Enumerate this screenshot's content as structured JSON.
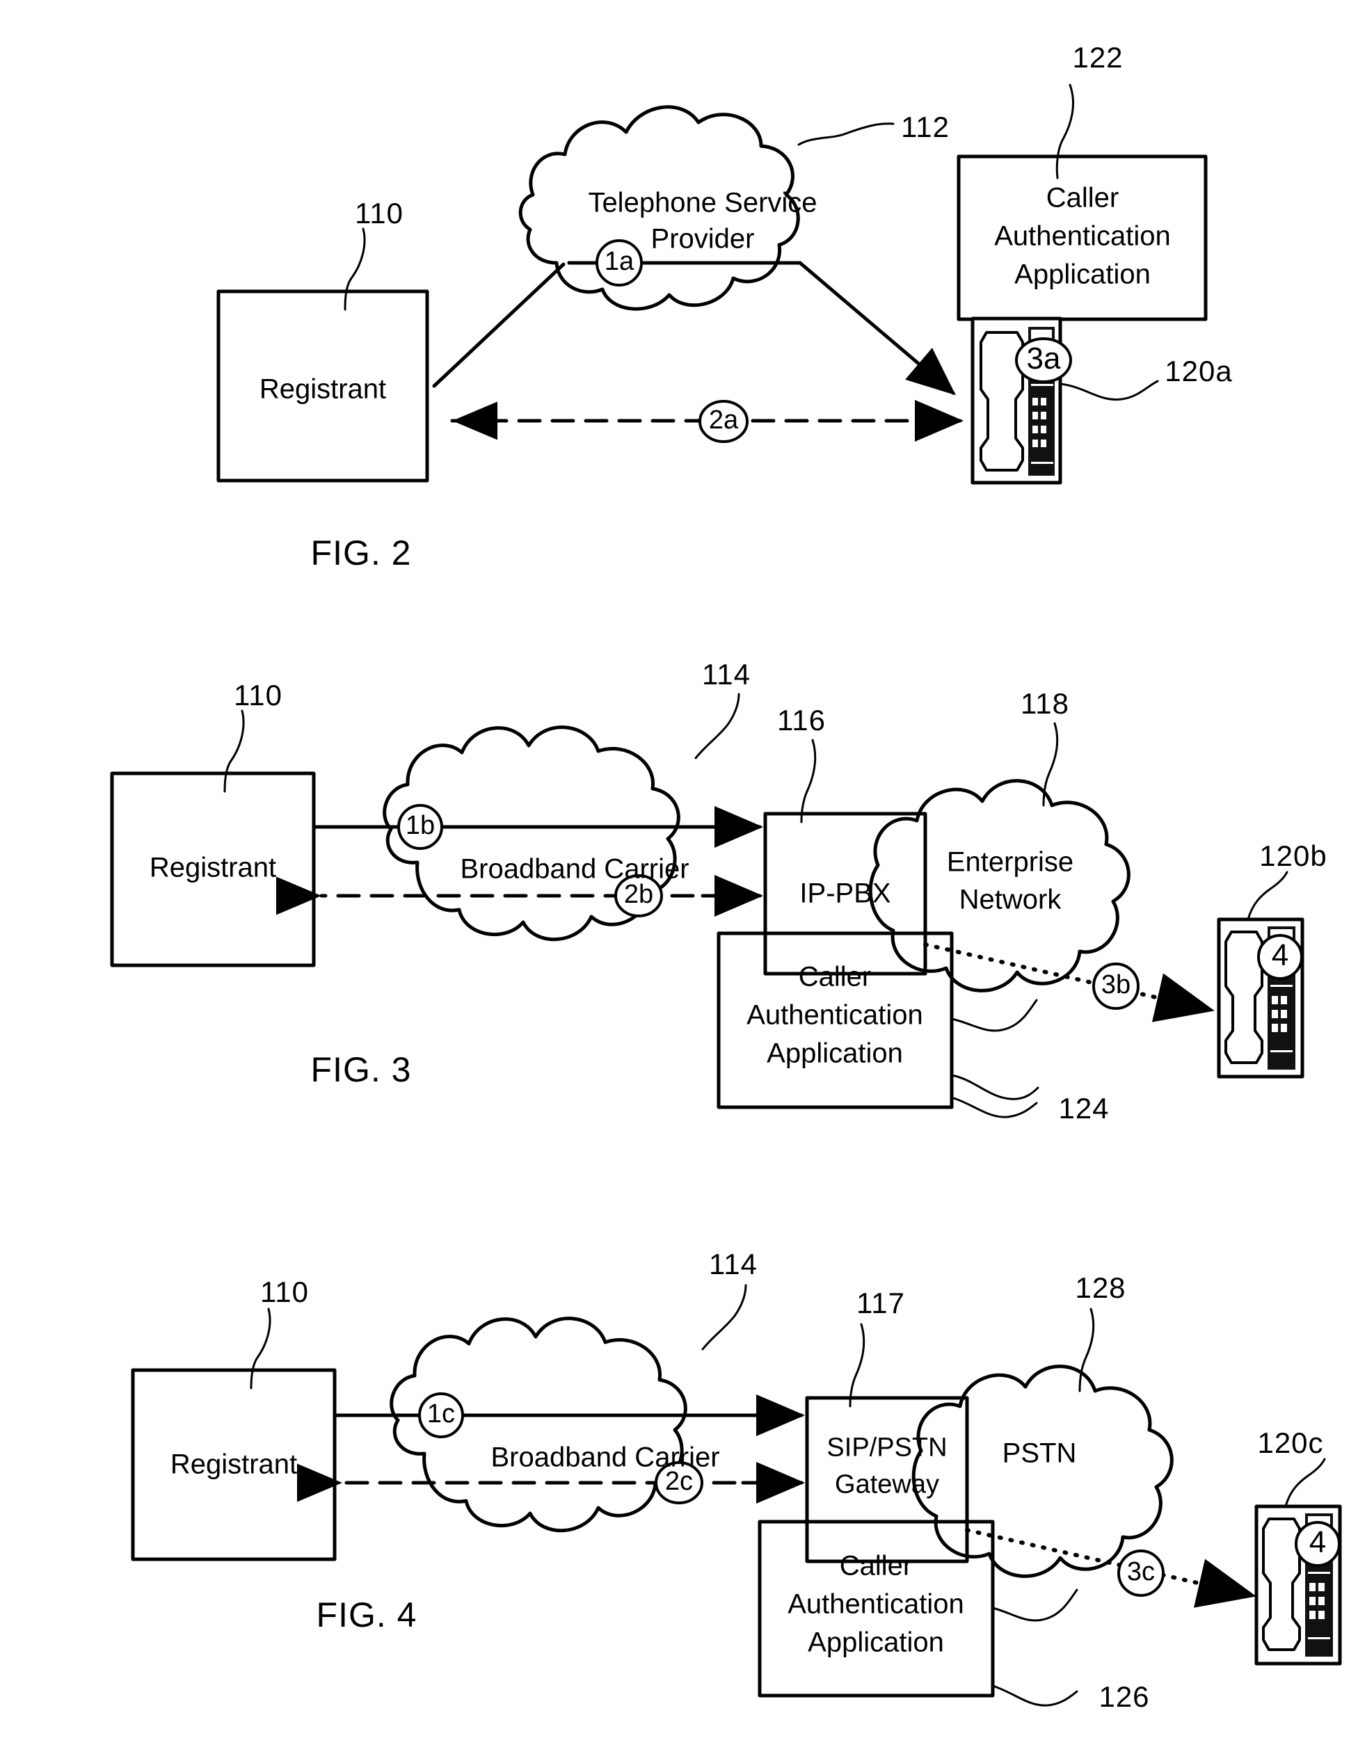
{
  "document": {
    "type": "patent-drawing-sheet",
    "figures": [
      "FIG. 2",
      "FIG. 3",
      "FIG. 4"
    ]
  },
  "fig2": {
    "caption": "FIG. 2",
    "registrant": {
      "label": "Registrant",
      "ref": "110"
    },
    "cloud": {
      "label_line1": "Telephone Service",
      "label_line2": "Provider",
      "ref": "112"
    },
    "app_box": {
      "line1": "Caller",
      "line2": "Authentication",
      "line3": "Application",
      "ref": "122"
    },
    "phone": {
      "ref": "120a",
      "badge": "3a"
    },
    "steps": {
      "s1": "1a",
      "s2": "2a",
      "s3": "3a"
    }
  },
  "fig3": {
    "caption": "FIG. 3",
    "registrant": {
      "label": "Registrant",
      "ref": "110"
    },
    "carrier_cloud": {
      "label": "Broadband Carrier",
      "ref": "114"
    },
    "pbx": {
      "label": "IP-PBX",
      "ref": "116"
    },
    "enterprise_cloud": {
      "label_line1": "Enterprise",
      "label_line2": "Network",
      "ref": "118"
    },
    "app_box": {
      "line1": "Caller",
      "line2": "Authentication",
      "line3": "Application",
      "ref": "124"
    },
    "phone": {
      "ref": "120b",
      "badge": "4"
    },
    "steps": {
      "s1": "1b",
      "s2": "2b",
      "s3": "3b",
      "s4": "4"
    }
  },
  "fig4": {
    "caption": "FIG. 4",
    "registrant": {
      "label": "Registrant",
      "ref": "110"
    },
    "carrier_cloud": {
      "label": "Broadband Carrier",
      "ref": "114"
    },
    "gateway": {
      "line1": "SIP/PSTN",
      "line2": "Gateway",
      "ref": "117"
    },
    "pstn_cloud": {
      "label": "PSTN",
      "ref": "128"
    },
    "app_box": {
      "line1": "Caller",
      "line2": "Authentication",
      "line3": "Application",
      "ref": "126"
    },
    "phone": {
      "ref": "120c",
      "badge": "4"
    },
    "steps": {
      "s1": "1c",
      "s2": "2c",
      "s3": "3c",
      "s4": "4"
    }
  },
  "colors": {
    "ink": "#000000",
    "paper": "#ffffff"
  }
}
